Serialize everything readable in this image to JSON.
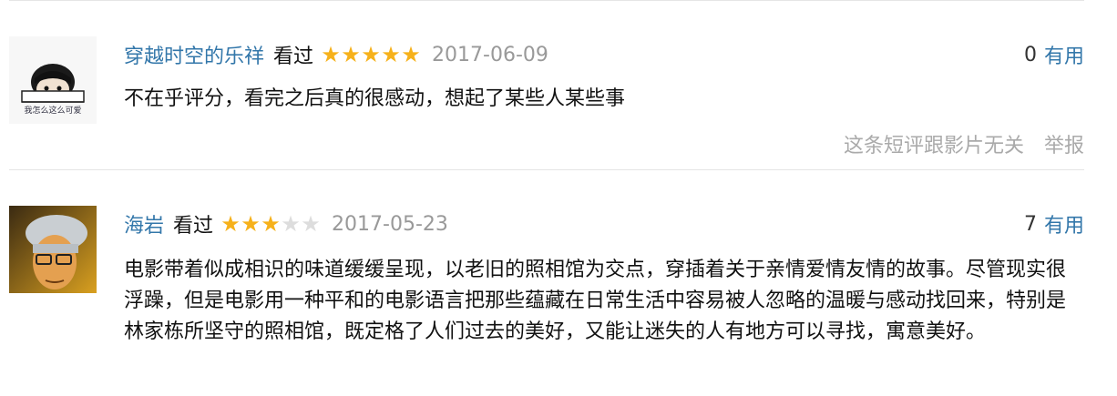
{
  "comments": [
    {
      "user": "穿越时空的乐祥",
      "watched_label": "看过",
      "rating": 5,
      "date": "2017-06-09",
      "vote_count": "0",
      "vote_label": "有用",
      "text": "不在乎评分，看完之后真的很感动，想起了某些人某些事",
      "unrelated_label": "这条短评跟影片无关",
      "report_label": "举报",
      "avatar_caption": "我怎么这么可爱"
    },
    {
      "user": "海岩",
      "watched_label": "看过",
      "rating": 3,
      "date": "2017-05-23",
      "vote_count": "7",
      "vote_label": "有用",
      "text": "电影带着似成相识的味道缓缓呈现，以老旧的照相馆为交点，穿插着关于亲情爱情友情的故事。尽管现实很浮躁，但是电影用一种平和的电影语言把那些蕴藏在日常生活中容易被人忽略的温暖与感动找回来，特别是林家栋所坚守的照相馆，既定格了人们过去的美好，又能让迷失的人有地方可以寻找，寓意美好。"
    }
  ],
  "colors": {
    "link": "#3377aa",
    "star_on": "#f6b11b",
    "star_off": "#dddddd",
    "muted": "#999999"
  }
}
